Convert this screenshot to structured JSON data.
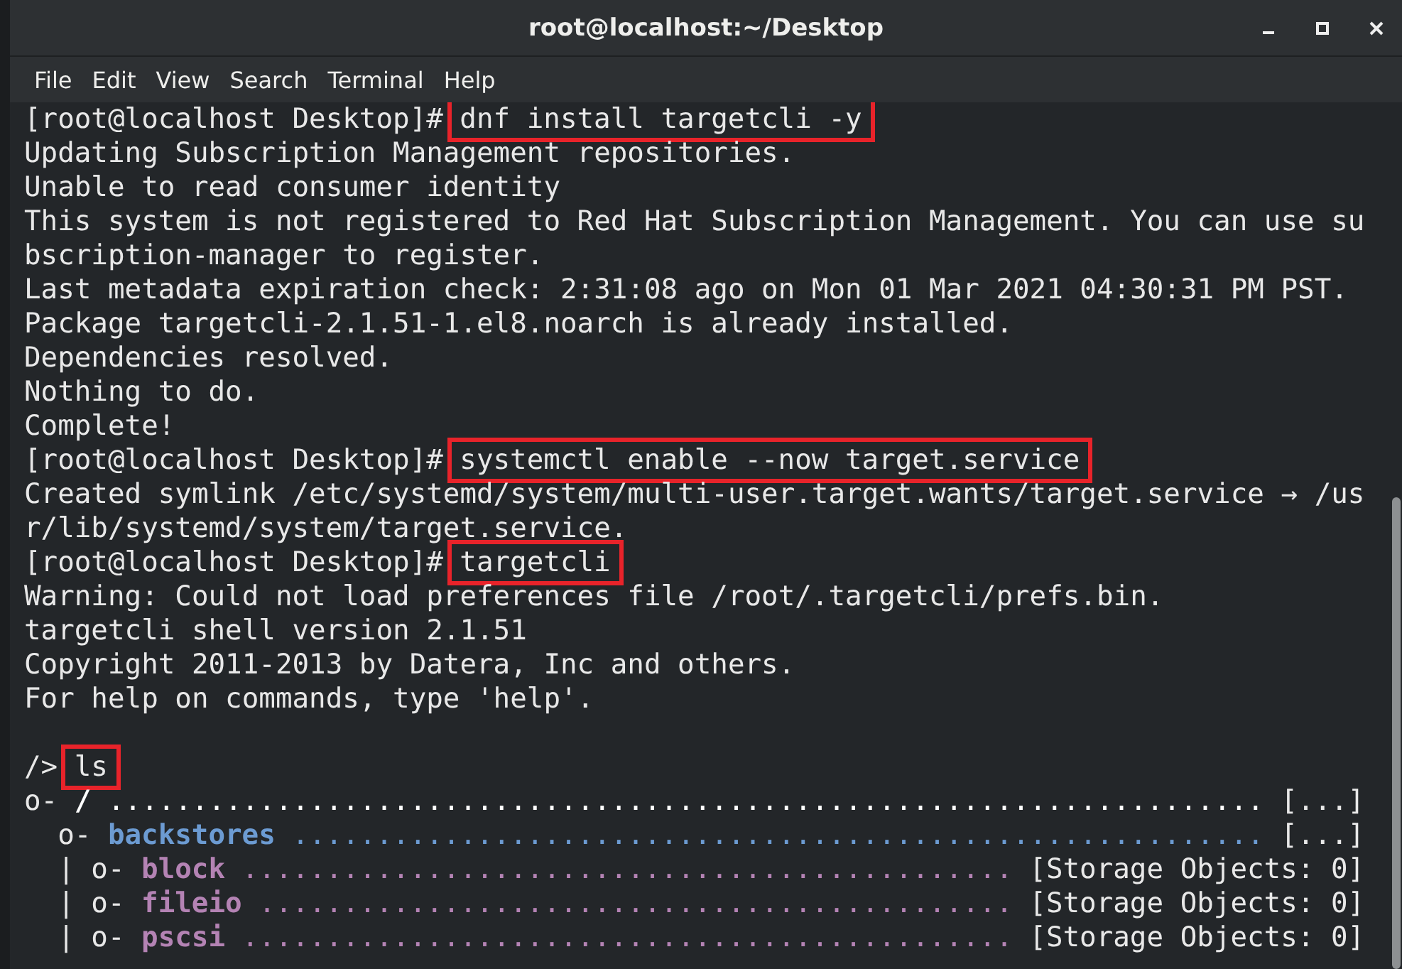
{
  "window": {
    "title": "root@localhost:~/Desktop"
  },
  "menu": [
    "File",
    "Edit",
    "View",
    "Search",
    "Terminal",
    "Help"
  ],
  "terminal": {
    "lines": [
      {
        "kind": "prompt",
        "prompt": "[root@localhost Desktop]#",
        "command": "dnf install targetcli -y",
        "highlighted": true
      },
      {
        "kind": "output",
        "text": "Updating Subscription Management repositories."
      },
      {
        "kind": "output",
        "text": "Unable to read consumer identity"
      },
      {
        "kind": "output",
        "text": "This system is not registered to Red Hat Subscription Management. You can use su"
      },
      {
        "kind": "output",
        "text": "bscription-manager to register."
      },
      {
        "kind": "output",
        "text": "Last metadata expiration check: 2:31:08 ago on Mon 01 Mar 2021 04:30:31 PM PST."
      },
      {
        "kind": "output",
        "text": "Package targetcli-2.1.51-1.el8.noarch is already installed."
      },
      {
        "kind": "output",
        "text": "Dependencies resolved."
      },
      {
        "kind": "output",
        "text": "Nothing to do."
      },
      {
        "kind": "output",
        "text": "Complete!"
      },
      {
        "kind": "prompt",
        "prompt": "[root@localhost Desktop]#",
        "command": "systemctl enable --now target.service",
        "highlighted": true
      },
      {
        "kind": "output",
        "text": "Created symlink /etc/systemd/system/multi-user.target.wants/target.service → /us"
      },
      {
        "kind": "output",
        "text": "r/lib/systemd/system/target.service."
      },
      {
        "kind": "prompt",
        "prompt": "[root@localhost Desktop]#",
        "command": "targetcli",
        "highlighted": true
      },
      {
        "kind": "output",
        "text": "Warning: Could not load preferences file /root/.targetcli/prefs.bin."
      },
      {
        "kind": "output",
        "text": "targetcli shell version 2.1.51"
      },
      {
        "kind": "output",
        "text": "Copyright 2011-2013 by Datera, Inc and others."
      },
      {
        "kind": "output",
        "text": "For help on commands, type 'help'."
      },
      {
        "kind": "blank"
      },
      {
        "kind": "prompt",
        "prompt": "/>",
        "command": "ls",
        "highlighted": true
      }
    ]
  },
  "tree": [
    {
      "prefix": "o-",
      "name": "/",
      "leader": ".....................................................................",
      "value": "[...]",
      "color": "#ffffff",
      "children": [
        {
          "prefix": "o-",
          "name": "backstores",
          "leader": "..........................................................",
          "value": "[...]",
          "color": "#6c9bd2",
          "children": [
            {
              "prefix": "| o-",
              "name": "block",
              "leader": "..............................................",
              "value": "[Storage Objects: 0]",
              "color": "#b483b4"
            },
            {
              "prefix": "| o-",
              "name": "fileio",
              "leader": ".............................................",
              "value": "[Storage Objects: 0]",
              "color": "#b483b4"
            },
            {
              "prefix": "| o-",
              "name": "pscsi",
              "leader": "..............................................",
              "value": "[Storage Objects: 0]",
              "color": "#b483b4"
            }
          ]
        }
      ]
    }
  ]
}
